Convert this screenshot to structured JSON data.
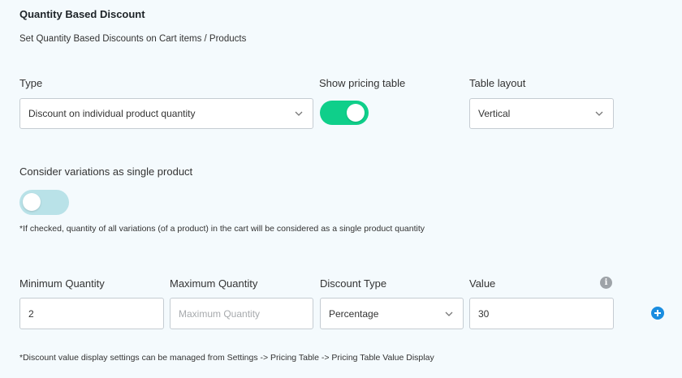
{
  "section": {
    "title": "Quantity Based Discount",
    "subtitle": "Set Quantity Based Discounts on Cart items / Products"
  },
  "type": {
    "label": "Type",
    "selected": "Discount on individual product quantity"
  },
  "pricing_table": {
    "label": "Show pricing table",
    "enabled": true
  },
  "table_layout": {
    "label": "Table layout",
    "selected": "Vertical"
  },
  "variations": {
    "label": "Consider variations as single product",
    "enabled": false,
    "note": "*If checked, quantity of all variations (of a product) in the cart will be considered as a single product quantity"
  },
  "rule": {
    "min_label": "Minimum Quantity",
    "min_value": "2",
    "max_label": "Maximum Quantity",
    "max_placeholder": "Maximum Quantity",
    "max_value": "",
    "discount_type_label": "Discount Type",
    "discount_type_selected": "Percentage",
    "value_label": "Value",
    "value": "30"
  },
  "footer_note": "*Discount value display settings can be managed from Settings -> Pricing Table -> Pricing Table Value Display",
  "colors": {
    "toggle_on": "#0fcf8a",
    "toggle_off": "#b9e2e8",
    "add_button": "#1a8de0",
    "info_icon": "#9ea3a8"
  },
  "icons": {
    "chevron": "chevron-down-icon",
    "info": "info-icon",
    "add": "plus-circle-icon"
  }
}
